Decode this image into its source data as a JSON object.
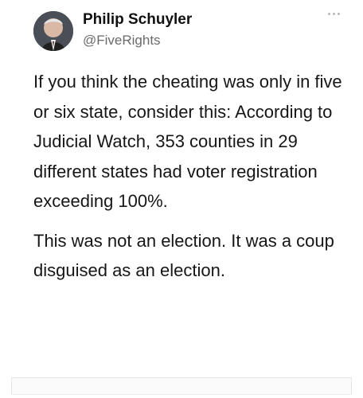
{
  "tweet": {
    "author": {
      "display_name": "Philip Schuyler",
      "handle": "@FiveRights",
      "avatar_icon": "profile-photo"
    },
    "more_icon": "more-options-icon",
    "body": {
      "paragraph_1": "If you think the cheating was only in five or six state, consider this: According to Judicial Watch, 353 counties in 29 different states had voter registration exceeding 100%.",
      "paragraph_2": "This was not an election. It was a coup disguised as an election."
    }
  },
  "colors": {
    "background": "#ffffff",
    "text": "#161616",
    "handle": "#6b6b6b",
    "more_dots": "#b7b7b7"
  }
}
